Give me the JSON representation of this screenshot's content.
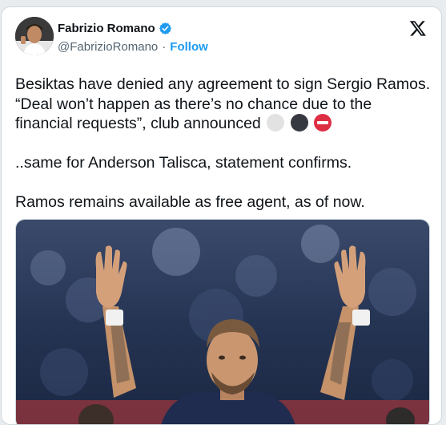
{
  "tweet": {
    "author_name": "Fabrizio Romano",
    "handle": "@FabrizioRomano",
    "separator": "·",
    "follow_label": "Follow",
    "line1": "Besiktas have denied any agreement to sign Sergio Ramos. “Deal won’t happen as there’s no chance due to the financial requests”, club announced ",
    "line2": "..same for Anderson Talisca, statement confirms.",
    "line3": "Ramos remains available as free agent, as of now.",
    "emojis": [
      "white-circle",
      "black-circle",
      "no-entry"
    ]
  },
  "colors": {
    "accent": "#1d9bf0",
    "text": "#0f1419",
    "secondary": "#536471",
    "border": "#cfd9de"
  }
}
